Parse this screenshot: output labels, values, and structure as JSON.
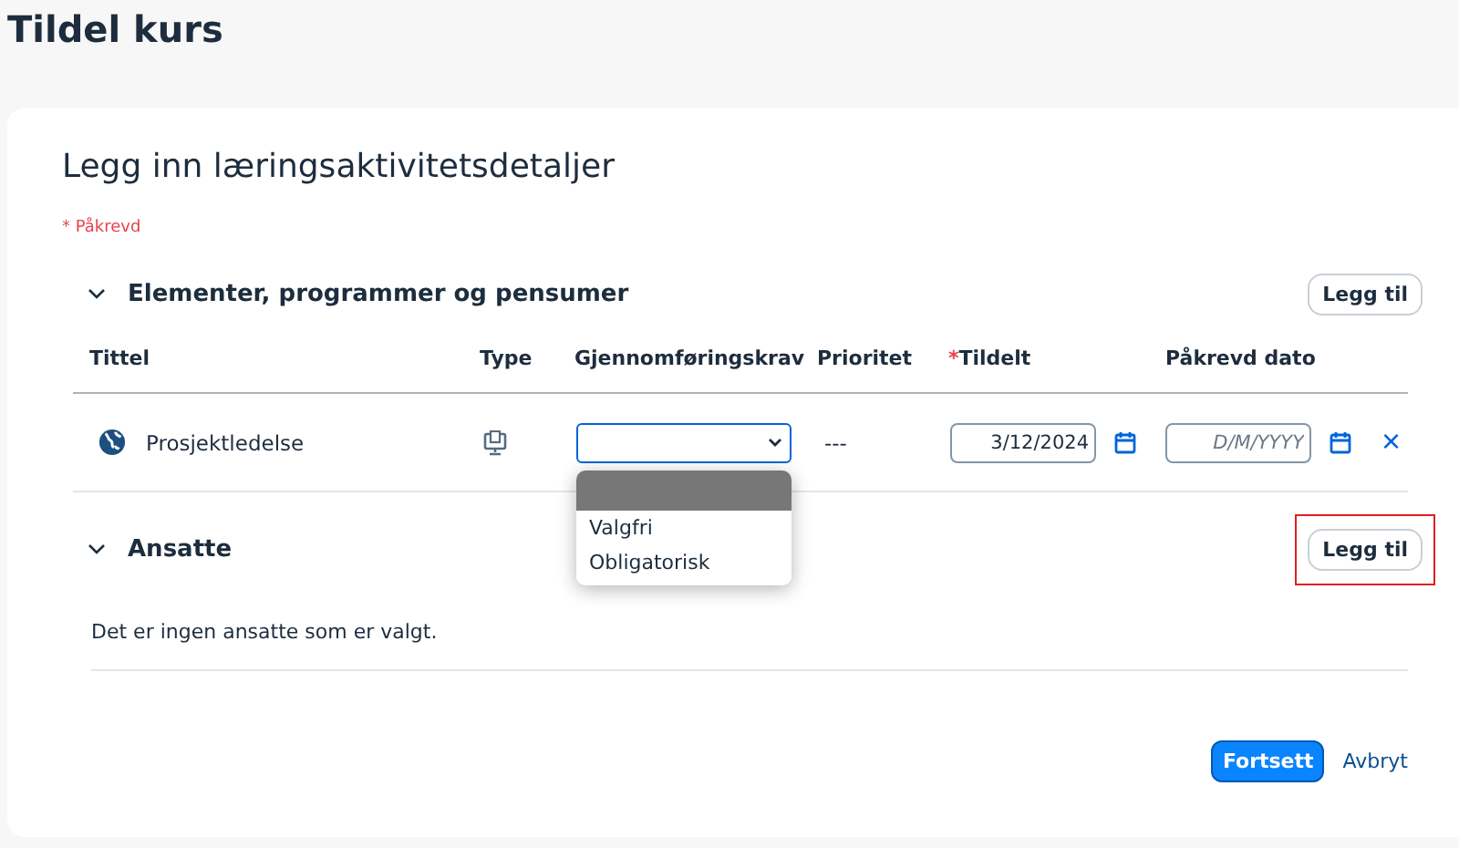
{
  "page_title": "Tildel kurs",
  "form": {
    "heading": "Legg inn læringsaktivitetsdetaljer",
    "required_note": "* Påkrevd"
  },
  "sections": [
    {
      "title": "Elementer, programmer og pensumer",
      "expanded": true,
      "add_button": {
        "label": "Legg til",
        "highlighted": false
      },
      "table": {
        "columns": [
          {
            "label": "Tittel",
            "required": false
          },
          {
            "label": "Type",
            "required": false
          },
          {
            "label": "Gjennomføringskrav",
            "required": false
          },
          {
            "label": "Prioritet",
            "required": false
          },
          {
            "label": "Tildelt",
            "required": true,
            "marker": "*"
          },
          {
            "label": "Påkrevd dato",
            "required": false
          }
        ],
        "rows": [
          {
            "title": "Prosjektledelse",
            "priority": "---",
            "assigned": {
              "value": "3/12/2024"
            },
            "due": {
              "placeholder": "D/M/YYYY"
            },
            "remove": "×",
            "completion": {
              "open": true,
              "blank_highlighted": true,
              "options": [
                {
                  "label": "Valgfri",
                  "selected": false
                },
                {
                  "label": "Obligatorisk",
                  "selected": false
                }
              ]
            }
          }
        ]
      }
    },
    {
      "title": "Ansatte",
      "expanded": true,
      "add_button": {
        "label": "Legg til",
        "highlighted": true
      },
      "empty_text": "Det er ingen ansatte som er valgt."
    }
  ],
  "footer": {
    "buttons": [
      {
        "label": "Fortsett",
        "kind": "primary"
      },
      {
        "label": "Avbryt",
        "kind": "link"
      }
    ]
  }
}
